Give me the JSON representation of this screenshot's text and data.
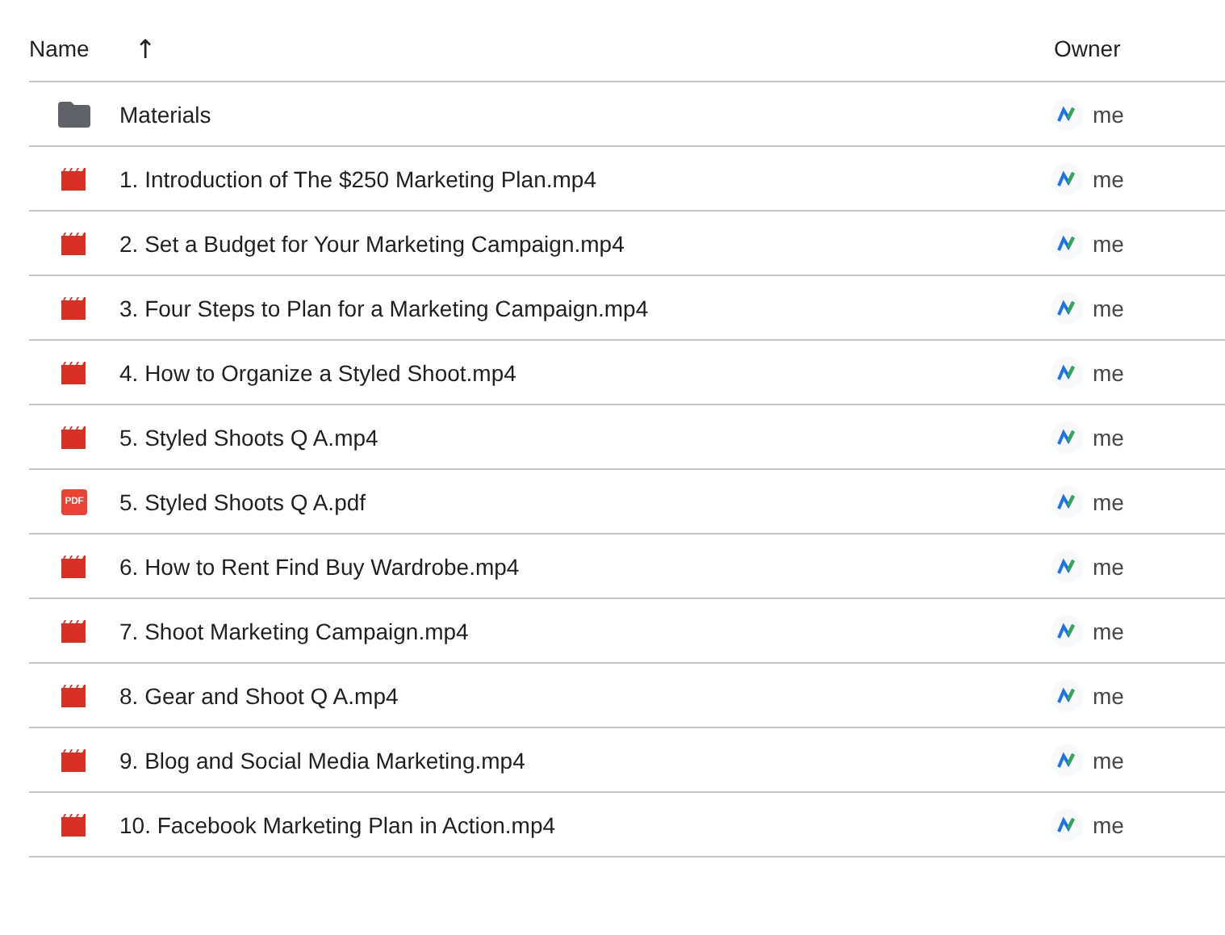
{
  "columns": [
    {
      "label": "Name",
      "sort_icon": "↑"
    },
    {
      "label": "Owner"
    }
  ],
  "rows": [
    {
      "kind": "folder",
      "name": "Materials",
      "owner": "me"
    },
    {
      "kind": "video",
      "name": "1. Introduction of The $250 Marketing Plan.mp4",
      "owner": "me"
    },
    {
      "kind": "video",
      "name": "2. Set a Budget for Your Marketing Campaign.mp4",
      "owner": "me"
    },
    {
      "kind": "video",
      "name": "3. Four Steps to Plan for a Marketing Campaign.mp4",
      "owner": "me"
    },
    {
      "kind": "video",
      "name": "4. How to Organize a Styled Shoot.mp4",
      "owner": "me"
    },
    {
      "kind": "video",
      "name": "5. Styled Shoots Q A.mp4",
      "owner": "me"
    },
    {
      "kind": "pdf",
      "name": "5. Styled Shoots Q A.pdf",
      "owner": "me",
      "icon_text": "PDF"
    },
    {
      "kind": "video",
      "name": "6. How to Rent Find Buy Wardrobe.mp4",
      "owner": "me"
    },
    {
      "kind": "video",
      "name": "7. Shoot Marketing Campaign.mp4",
      "owner": "me"
    },
    {
      "kind": "video",
      "name": "8. Gear and Shoot Q A.mp4",
      "owner": "me"
    },
    {
      "kind": "video",
      "name": "9. Blog and Social Media Marketing.mp4",
      "owner": "me"
    },
    {
      "kind": "video",
      "name": "10. Facebook Marketing Plan in Action.mp4",
      "owner": "me"
    }
  ]
}
